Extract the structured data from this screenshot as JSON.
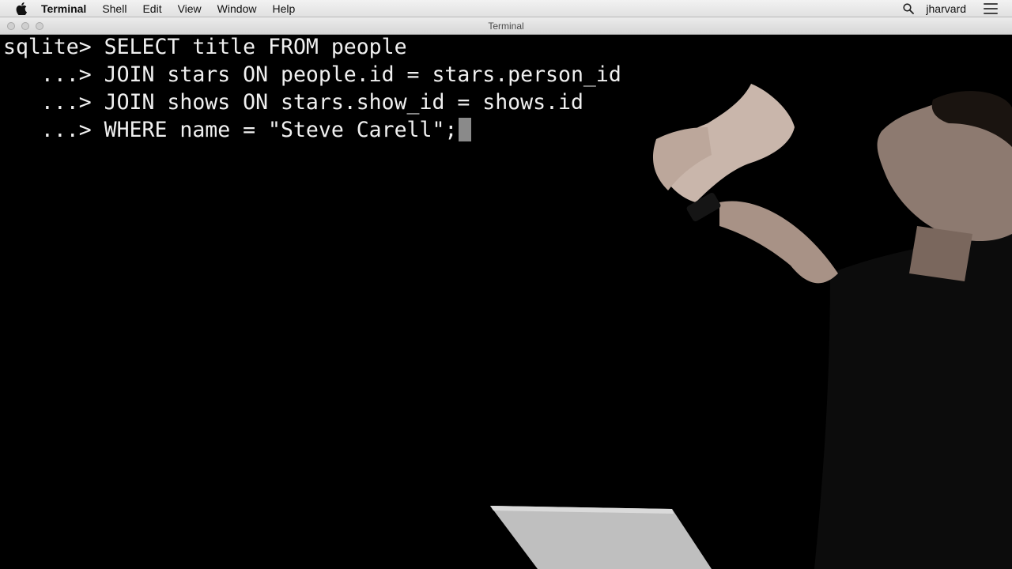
{
  "menubar": {
    "apple_icon": "apple-icon",
    "items": [
      {
        "label": "Terminal",
        "app": true
      },
      {
        "label": "Shell"
      },
      {
        "label": "Edit"
      },
      {
        "label": "View"
      },
      {
        "label": "Window"
      },
      {
        "label": "Help"
      }
    ],
    "search_icon": "search-icon",
    "user": "jharvard",
    "list_icon": "list-icon"
  },
  "window": {
    "title": "Terminal"
  },
  "terminal": {
    "lines": [
      {
        "prompt": "sqlite> ",
        "code": "SELECT title FROM people"
      },
      {
        "prompt": "   ...> ",
        "code": "JOIN stars ON people.id = stars.person_id"
      },
      {
        "prompt": "   ...> ",
        "code": "JOIN shows ON stars.show_id = shows.id"
      },
      {
        "prompt": "   ...> ",
        "code": "WHERE name = \"Steve Carell\";"
      }
    ],
    "colors": {
      "background": "#000000",
      "foreground": "#f0f0f0",
      "cursor": "#8a8a8a"
    }
  }
}
